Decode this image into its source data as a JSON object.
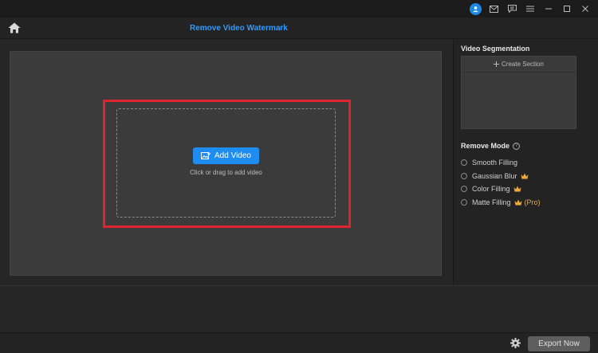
{
  "header": {
    "title": "Remove Video Watermark"
  },
  "titlebar": {
    "icons": [
      "user-avatar-icon",
      "mail-icon",
      "feedback-icon",
      "menu-icon",
      "minimize-icon",
      "maximize-icon",
      "close-icon"
    ]
  },
  "workspace": {
    "add_video_label": "Add Video",
    "hint": "Click or drag to add video"
  },
  "segmentation": {
    "title": "Video Segmentation",
    "create_label": "Create Section"
  },
  "remove_mode": {
    "title": "Remove Mode",
    "options": [
      {
        "label": "Smooth Filling",
        "premium": false,
        "pro": ""
      },
      {
        "label": "Gaussian Blur",
        "premium": true,
        "pro": ""
      },
      {
        "label": "Color Filling",
        "premium": true,
        "pro": ""
      },
      {
        "label": "Matte Filling",
        "premium": true,
        "pro": "(Pro)"
      }
    ]
  },
  "footer": {
    "export_label": "Export Now"
  },
  "colors": {
    "accent": "#1e8cf0",
    "title": "#2f9bff",
    "highlight": "#e0242f",
    "premium": "#f0a93a"
  }
}
